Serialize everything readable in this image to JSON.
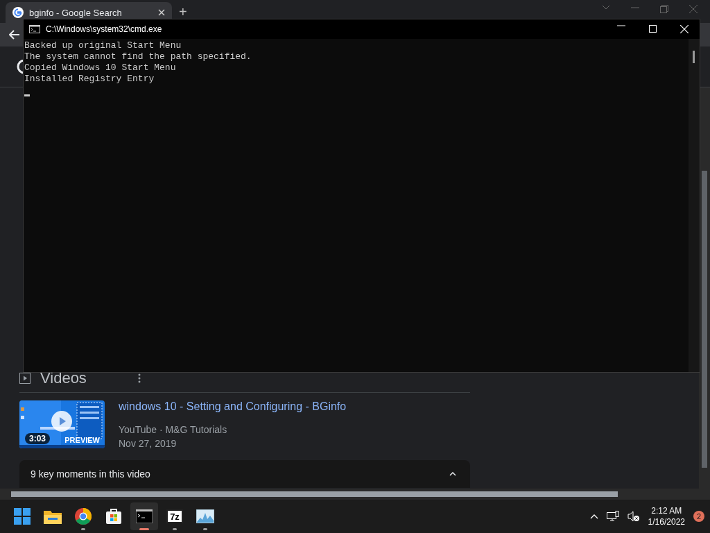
{
  "browser": {
    "tabs": [
      {
        "title": "bginfo - Google Search",
        "selected": true
      }
    ],
    "new_tab": "+",
    "videos": {
      "heading": "Videos",
      "items": [
        {
          "title": "windows 10 - Setting and Configuring - BGinfo",
          "duration": "3:03",
          "badge": "PREVIEW",
          "source": "YouTube · M&G Tutorials",
          "date": "Nov 27, 2019"
        }
      ],
      "key_moments": {
        "label": "9 key moments in this video",
        "expanded": true
      }
    }
  },
  "console": {
    "title": "C:\\Windows\\system32\\cmd.exe",
    "lines": [
      "Backed up original Start Menu",
      "The system cannot find the path specified.",
      "Copied Windows 10 Start Menu",
      "Installed Registry Entry"
    ]
  },
  "taskbar": {
    "apps": [
      {
        "kind": "start",
        "running": false,
        "active": false
      },
      {
        "kind": "folder",
        "running": false,
        "active": false
      },
      {
        "kind": "chrome",
        "running": true,
        "active": false
      },
      {
        "kind": "store",
        "running": false,
        "active": false
      },
      {
        "kind": "console",
        "running": true,
        "active": true
      },
      {
        "kind": "archiver",
        "label": "7z",
        "running": true,
        "active": false
      },
      {
        "kind": "monitor",
        "running": true,
        "active": false
      }
    ],
    "tray": {
      "time": "2:12 AM",
      "date": "1/16/2022",
      "notifications": "2"
    }
  }
}
